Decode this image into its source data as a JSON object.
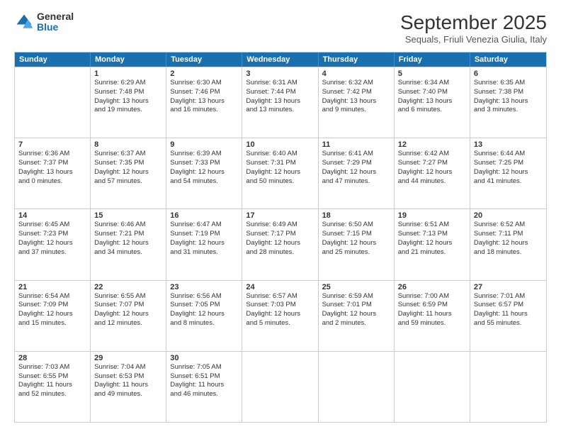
{
  "logo": {
    "general": "General",
    "blue": "Blue"
  },
  "header": {
    "month_year": "September 2025",
    "location": "Sequals, Friuli Venezia Giulia, Italy"
  },
  "days_of_week": [
    "Sunday",
    "Monday",
    "Tuesday",
    "Wednesday",
    "Thursday",
    "Friday",
    "Saturday"
  ],
  "weeks": [
    [
      {
        "day": "",
        "info": ""
      },
      {
        "day": "1",
        "info": "Sunrise: 6:29 AM\nSunset: 7:48 PM\nDaylight: 13 hours\nand 19 minutes."
      },
      {
        "day": "2",
        "info": "Sunrise: 6:30 AM\nSunset: 7:46 PM\nDaylight: 13 hours\nand 16 minutes."
      },
      {
        "day": "3",
        "info": "Sunrise: 6:31 AM\nSunset: 7:44 PM\nDaylight: 13 hours\nand 13 minutes."
      },
      {
        "day": "4",
        "info": "Sunrise: 6:32 AM\nSunset: 7:42 PM\nDaylight: 13 hours\nand 9 minutes."
      },
      {
        "day": "5",
        "info": "Sunrise: 6:34 AM\nSunset: 7:40 PM\nDaylight: 13 hours\nand 6 minutes."
      },
      {
        "day": "6",
        "info": "Sunrise: 6:35 AM\nSunset: 7:38 PM\nDaylight: 13 hours\nand 3 minutes."
      }
    ],
    [
      {
        "day": "7",
        "info": "Sunrise: 6:36 AM\nSunset: 7:37 PM\nDaylight: 13 hours\nand 0 minutes."
      },
      {
        "day": "8",
        "info": "Sunrise: 6:37 AM\nSunset: 7:35 PM\nDaylight: 12 hours\nand 57 minutes."
      },
      {
        "day": "9",
        "info": "Sunrise: 6:39 AM\nSunset: 7:33 PM\nDaylight: 12 hours\nand 54 minutes."
      },
      {
        "day": "10",
        "info": "Sunrise: 6:40 AM\nSunset: 7:31 PM\nDaylight: 12 hours\nand 50 minutes."
      },
      {
        "day": "11",
        "info": "Sunrise: 6:41 AM\nSunset: 7:29 PM\nDaylight: 12 hours\nand 47 minutes."
      },
      {
        "day": "12",
        "info": "Sunrise: 6:42 AM\nSunset: 7:27 PM\nDaylight: 12 hours\nand 44 minutes."
      },
      {
        "day": "13",
        "info": "Sunrise: 6:44 AM\nSunset: 7:25 PM\nDaylight: 12 hours\nand 41 minutes."
      }
    ],
    [
      {
        "day": "14",
        "info": "Sunrise: 6:45 AM\nSunset: 7:23 PM\nDaylight: 12 hours\nand 37 minutes."
      },
      {
        "day": "15",
        "info": "Sunrise: 6:46 AM\nSunset: 7:21 PM\nDaylight: 12 hours\nand 34 minutes."
      },
      {
        "day": "16",
        "info": "Sunrise: 6:47 AM\nSunset: 7:19 PM\nDaylight: 12 hours\nand 31 minutes."
      },
      {
        "day": "17",
        "info": "Sunrise: 6:49 AM\nSunset: 7:17 PM\nDaylight: 12 hours\nand 28 minutes."
      },
      {
        "day": "18",
        "info": "Sunrise: 6:50 AM\nSunset: 7:15 PM\nDaylight: 12 hours\nand 25 minutes."
      },
      {
        "day": "19",
        "info": "Sunrise: 6:51 AM\nSunset: 7:13 PM\nDaylight: 12 hours\nand 21 minutes."
      },
      {
        "day": "20",
        "info": "Sunrise: 6:52 AM\nSunset: 7:11 PM\nDaylight: 12 hours\nand 18 minutes."
      }
    ],
    [
      {
        "day": "21",
        "info": "Sunrise: 6:54 AM\nSunset: 7:09 PM\nDaylight: 12 hours\nand 15 minutes."
      },
      {
        "day": "22",
        "info": "Sunrise: 6:55 AM\nSunset: 7:07 PM\nDaylight: 12 hours\nand 12 minutes."
      },
      {
        "day": "23",
        "info": "Sunrise: 6:56 AM\nSunset: 7:05 PM\nDaylight: 12 hours\nand 8 minutes."
      },
      {
        "day": "24",
        "info": "Sunrise: 6:57 AM\nSunset: 7:03 PM\nDaylight: 12 hours\nand 5 minutes."
      },
      {
        "day": "25",
        "info": "Sunrise: 6:59 AM\nSunset: 7:01 PM\nDaylight: 12 hours\nand 2 minutes."
      },
      {
        "day": "26",
        "info": "Sunrise: 7:00 AM\nSunset: 6:59 PM\nDaylight: 11 hours\nand 59 minutes."
      },
      {
        "day": "27",
        "info": "Sunrise: 7:01 AM\nSunset: 6:57 PM\nDaylight: 11 hours\nand 55 minutes."
      }
    ],
    [
      {
        "day": "28",
        "info": "Sunrise: 7:03 AM\nSunset: 6:55 PM\nDaylight: 11 hours\nand 52 minutes."
      },
      {
        "day": "29",
        "info": "Sunrise: 7:04 AM\nSunset: 6:53 PM\nDaylight: 11 hours\nand 49 minutes."
      },
      {
        "day": "30",
        "info": "Sunrise: 7:05 AM\nSunset: 6:51 PM\nDaylight: 11 hours\nand 46 minutes."
      },
      {
        "day": "",
        "info": ""
      },
      {
        "day": "",
        "info": ""
      },
      {
        "day": "",
        "info": ""
      },
      {
        "day": "",
        "info": ""
      }
    ]
  ]
}
